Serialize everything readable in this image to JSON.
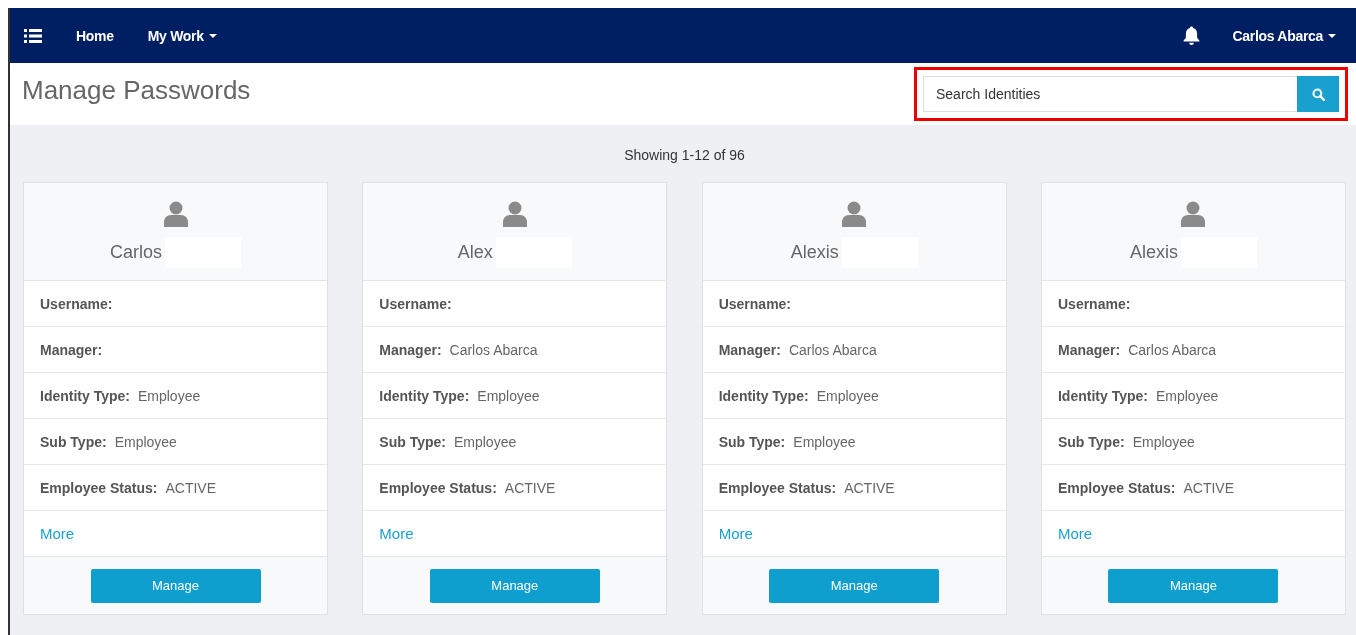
{
  "navbar": {
    "links": [
      {
        "label": "Home",
        "dropdown": false
      },
      {
        "label": "My Work",
        "dropdown": true
      }
    ],
    "user": "Carlos Abarca"
  },
  "header": {
    "title": "Manage Passwords",
    "search": {
      "placeholder": "Search Identities",
      "highlighted": true
    }
  },
  "summary": "Showing 1-12 of 96",
  "cards": [
    {
      "name": "Carlos",
      "fields": [
        {
          "label": "Username:"
        },
        {
          "label": "Manager:"
        },
        {
          "label": "Identity Type:",
          "value": "Employee"
        },
        {
          "label": "Sub Type:",
          "value": "Employee"
        },
        {
          "label": "Employee Status:",
          "value": "ACTIVE"
        }
      ],
      "link": "More",
      "button": "Manage"
    },
    {
      "name": "Alex",
      "fields": [
        {
          "label": "Username:"
        },
        {
          "label": "Manager:",
          "value": "Carlos Abarca"
        },
        {
          "label": "Identity Type:",
          "value": "Employee"
        },
        {
          "label": "Sub Type:",
          "value": "Employee"
        },
        {
          "label": "Employee Status:",
          "value": "ACTIVE"
        }
      ],
      "link": "More",
      "button": "Manage"
    },
    {
      "name": "Alexis",
      "fields": [
        {
          "label": "Username:"
        },
        {
          "label": "Manager:",
          "value": "Carlos Abarca"
        },
        {
          "label": "Identity Type:",
          "value": "Employee"
        },
        {
          "label": "Sub Type:",
          "value": "Employee"
        },
        {
          "label": "Employee Status:",
          "value": "ACTIVE"
        }
      ],
      "link": "More",
      "button": "Manage"
    },
    {
      "name": "Alexis",
      "fields": [
        {
          "label": "Username:"
        },
        {
          "label": "Manager:",
          "value": "Carlos Abarca"
        },
        {
          "label": "Identity Type:",
          "value": "Employee"
        },
        {
          "label": "Sub Type:",
          "value": "Employee"
        },
        {
          "label": "Employee Status:",
          "value": "ACTIVE"
        }
      ],
      "link": "More",
      "button": "Manage"
    }
  ]
}
